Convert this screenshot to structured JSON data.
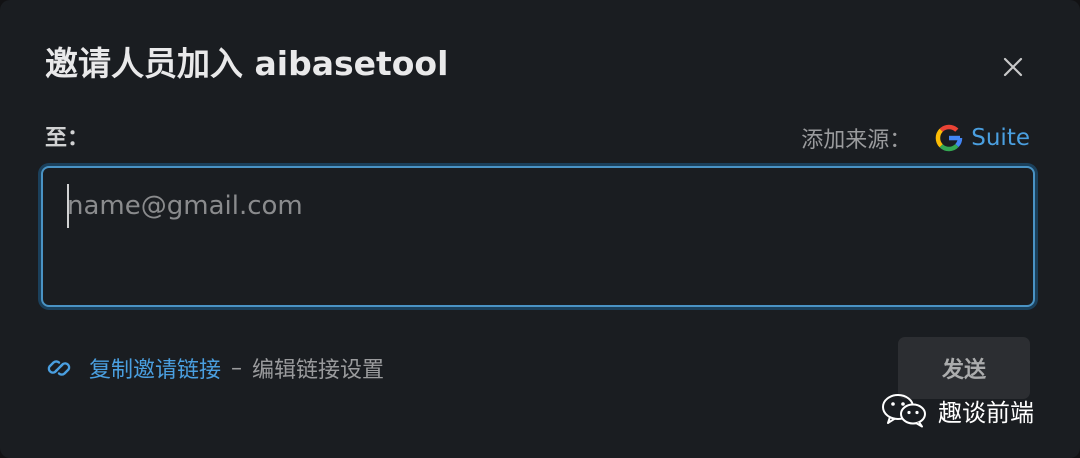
{
  "dialog": {
    "title": "邀请人员加入 aibasetool",
    "close_icon": "close-icon"
  },
  "recipients": {
    "to_label": "至：",
    "add_from_label": "添加来源：",
    "gsuite_label": "Suite",
    "gsuite_icon": "google-g-icon",
    "input_value": "",
    "placeholder": "name@gmail.com"
  },
  "footer": {
    "link_icon": "link-icon",
    "copy_link_label": "复制邀请链接",
    "separator": "–",
    "edit_link_label": "编辑链接设置",
    "send_label": "发送"
  },
  "watermark": {
    "icon": "wechat-icon",
    "text": "趣谈前端"
  },
  "colors": {
    "background": "#1a1d21",
    "accent_link": "#4a9fe0",
    "focus_border": "#4a93c4",
    "send_button": "#2c2e32"
  }
}
